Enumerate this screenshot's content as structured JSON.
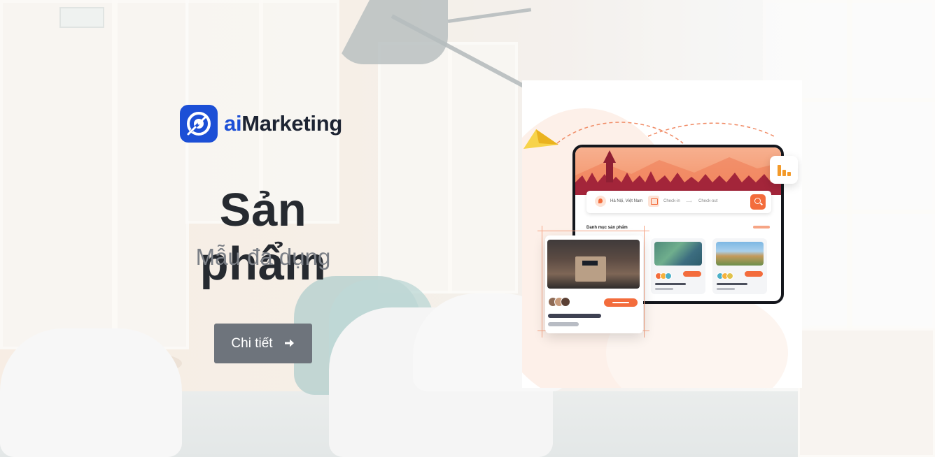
{
  "brand": {
    "name_prefix": "ai",
    "name_suffix": "Marketing",
    "logo_icon": "target-arrow-icon",
    "accent_color": "#1c4fd6"
  },
  "hero": {
    "title": "Sản phẩm",
    "subtitle": "Mẫu đa dụng",
    "cta_label": "Chi tiết",
    "cta_icon": "arrow-right-icon"
  },
  "illustration": {
    "search_location": "Hà Nội, Việt Nam",
    "check_in": "Check-in",
    "check_out": "Check-out",
    "section_title": "Danh mục sản phẩm",
    "accent_color": "#f36c3c"
  }
}
